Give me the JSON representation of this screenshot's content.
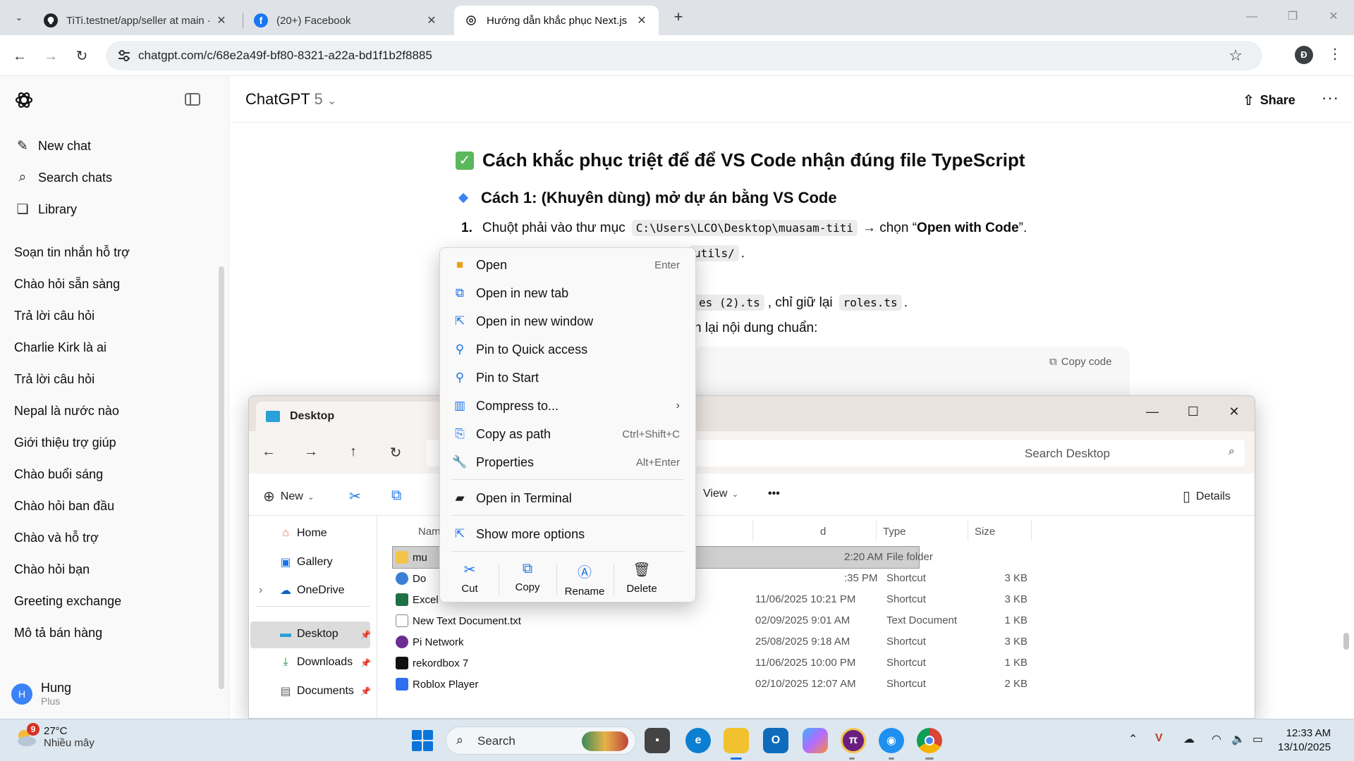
{
  "browser": {
    "tabs": [
      {
        "title": "TiTi.testnet/app/seller at main ·",
        "active": false
      },
      {
        "title": "(20+) Facebook",
        "active": false
      },
      {
        "title": "Hướng dẫn khắc phục Next.js",
        "active": true
      }
    ],
    "url": "chatgpt.com/c/68e2a49f-bf80-8321-a22a-bd1f1b2f8885",
    "profile_initial": "Đ"
  },
  "sidebar": {
    "actions": [
      {
        "label": "New chat",
        "icon": "edit-icon"
      },
      {
        "label": "Search chats",
        "icon": "search-icon"
      },
      {
        "label": "Library",
        "icon": "library-icon"
      }
    ],
    "chats": [
      "Soạn tin nhắn hỗ trợ",
      "Chào hỏi sẵn sàng",
      "Trả lời câu hỏi",
      "Charlie Kirk là ai",
      "Trả lời câu hỏi",
      "Nepal là nước nào",
      "Giới thiệu trợ giúp",
      "Chào buổi sáng",
      "Chào hỏi ban đầu",
      "Chào và hỗ trợ",
      "Chào hỏi bạn",
      "Greeting exchange",
      "Mô tả bán hàng"
    ],
    "user": {
      "initial": "H",
      "name": "Hung",
      "plan": "Plus"
    }
  },
  "chat": {
    "model_name": "ChatGPT",
    "model_version": "5",
    "share_label": "Share",
    "heading": "Cách khắc phục triệt để để VS Code nhận đúng file TypeScript",
    "subheading": "Cách 1: (Khuyên dùng) mở dự án bằng VS Code",
    "step1_num": "1.",
    "step1_pre": "Chuột phải vào thư mục",
    "step1_code": "C:\\Users\\LCO\\Desktop\\muasam-titi",
    "step1_mid": "→ chọn “",
    "step1_bold": "Open with Code",
    "step1_end": "”.",
    "line2_code": "utils/",
    "line2_end": ".",
    "line4_code": "es (2).ts",
    "line4_mid": ", chỉ giữ lại",
    "line4_code2": "roles.ts",
    "line4_end": ".",
    "line5_text": "n lại nội dung chuẩn:",
    "copy_code_label": "Copy code"
  },
  "explorer": {
    "title": "Desktop",
    "search_placeholder": "Search Desktop",
    "toolbar": {
      "new_label": "New",
      "view_label": "View",
      "more_label": "•••",
      "details_label": "Details"
    },
    "sidebar": [
      {
        "label": "Home",
        "icon": "home-icon"
      },
      {
        "label": "Gallery",
        "icon": "gallery-icon"
      },
      {
        "label": "OneDrive",
        "icon": "cloud-icon"
      },
      {
        "label": "Desktop",
        "icon": "desktop-icon",
        "selected": true
      },
      {
        "label": "Downloads",
        "icon": "download-icon"
      },
      {
        "label": "Documents",
        "icon": "documents-icon"
      }
    ],
    "columns": {
      "name": "Nam",
      "date": "d",
      "type": "Type",
      "size": "Size"
    },
    "rows": [
      {
        "name": "mu",
        "date": "2:20 AM",
        "type": "File folder",
        "size": "",
        "icon": "folder-icon",
        "selected": true
      },
      {
        "name": "Do",
        "date": ":35 PM",
        "type": "Shortcut",
        "size": "3 KB",
        "icon": "app-icon"
      },
      {
        "name": "Excel",
        "date": "11/06/2025 10:21 PM",
        "type": "Shortcut",
        "size": "3 KB",
        "icon": "excel-icon"
      },
      {
        "name": "New Text Document.txt",
        "date": "02/09/2025 9:01 AM",
        "type": "Text Document",
        "size": "1 KB",
        "icon": "text-file-icon"
      },
      {
        "name": "Pi Network",
        "date": "25/08/2025 9:18 AM",
        "type": "Shortcut",
        "size": "3 KB",
        "icon": "pi-network-icon"
      },
      {
        "name": "rekordbox 7",
        "date": "11/06/2025 10:00 PM",
        "type": "Shortcut",
        "size": "1 KB",
        "icon": "rekordbox-icon"
      },
      {
        "name": "Roblox Player",
        "date": "02/10/2025 12:07 AM",
        "type": "Shortcut",
        "size": "2 KB",
        "icon": "roblox-icon"
      }
    ]
  },
  "context_menu": {
    "items": [
      {
        "label": "Open",
        "shortcut": "Enter",
        "icon": "folder-icon"
      },
      {
        "label": "Open in new tab",
        "shortcut": "",
        "icon": "new-tab-icon"
      },
      {
        "label": "Open in new window",
        "shortcut": "",
        "icon": "new-window-icon"
      },
      {
        "label": "Pin to Quick access",
        "shortcut": "",
        "icon": "pin-icon"
      },
      {
        "label": "Pin to Start",
        "shortcut": "",
        "icon": "pin-icon"
      },
      {
        "label": "Compress to...",
        "shortcut": "",
        "icon": "zip-icon"
      },
      {
        "label": "Copy as path",
        "shortcut": "Ctrl+Shift+C",
        "icon": "copy-path-icon"
      },
      {
        "label": "Properties",
        "shortcut": "Alt+Enter",
        "icon": "wrench-icon"
      },
      {
        "label": "Open in Terminal",
        "shortcut": "",
        "icon": "terminal-icon"
      },
      {
        "label": "Show more options",
        "shortcut": "",
        "icon": "more-options-icon"
      }
    ],
    "actions": [
      {
        "label": "Cut",
        "icon": "scissors-icon"
      },
      {
        "label": "Copy",
        "icon": "copy-icon"
      },
      {
        "label": "Rename",
        "icon": "rename-icon"
      },
      {
        "label": "Delete",
        "icon": "trash-icon"
      }
    ]
  },
  "taskbar": {
    "weather_badge": "9",
    "temperature": "27°C",
    "weather_desc": "Nhiều mây",
    "search_placeholder": "Search",
    "time": "12:33 AM",
    "date": "13/10/2025"
  }
}
